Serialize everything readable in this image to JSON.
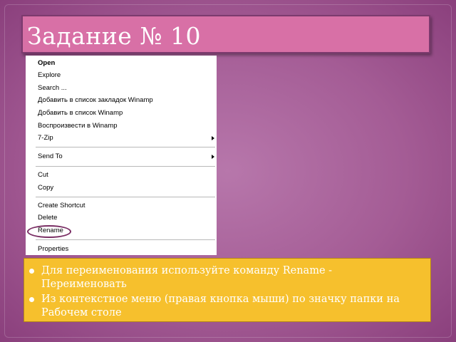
{
  "slide": {
    "title": "Задание № 10"
  },
  "context_menu": {
    "items": [
      {
        "label": "Open",
        "bold": true
      },
      {
        "label": "Explore"
      },
      {
        "label": "Search ..."
      },
      {
        "label": "Добавить в список закладок Winamp"
      },
      {
        "label": "Добавить в список Winamp"
      },
      {
        "label": "Воспроизвести в Winamp"
      },
      {
        "label": "7-Zip",
        "submenu": true
      },
      {
        "label": "Send To",
        "submenu": true
      },
      {
        "label": "Cut"
      },
      {
        "label": "Copy"
      },
      {
        "label": "Create Shortcut"
      },
      {
        "label": "Delete"
      },
      {
        "label": "Rename",
        "highlighted": true
      },
      {
        "label": "Properties"
      }
    ]
  },
  "notes": {
    "bullets": [
      "Для переименования используйте команду Rename - Переименовать",
      "Из контекстное меню (правая кнопка мыши) по значку папки на Рабочем столе"
    ]
  },
  "colors": {
    "background": "#a45c95",
    "title_bar": "#d870a6",
    "info_box": "#f6c02d"
  }
}
